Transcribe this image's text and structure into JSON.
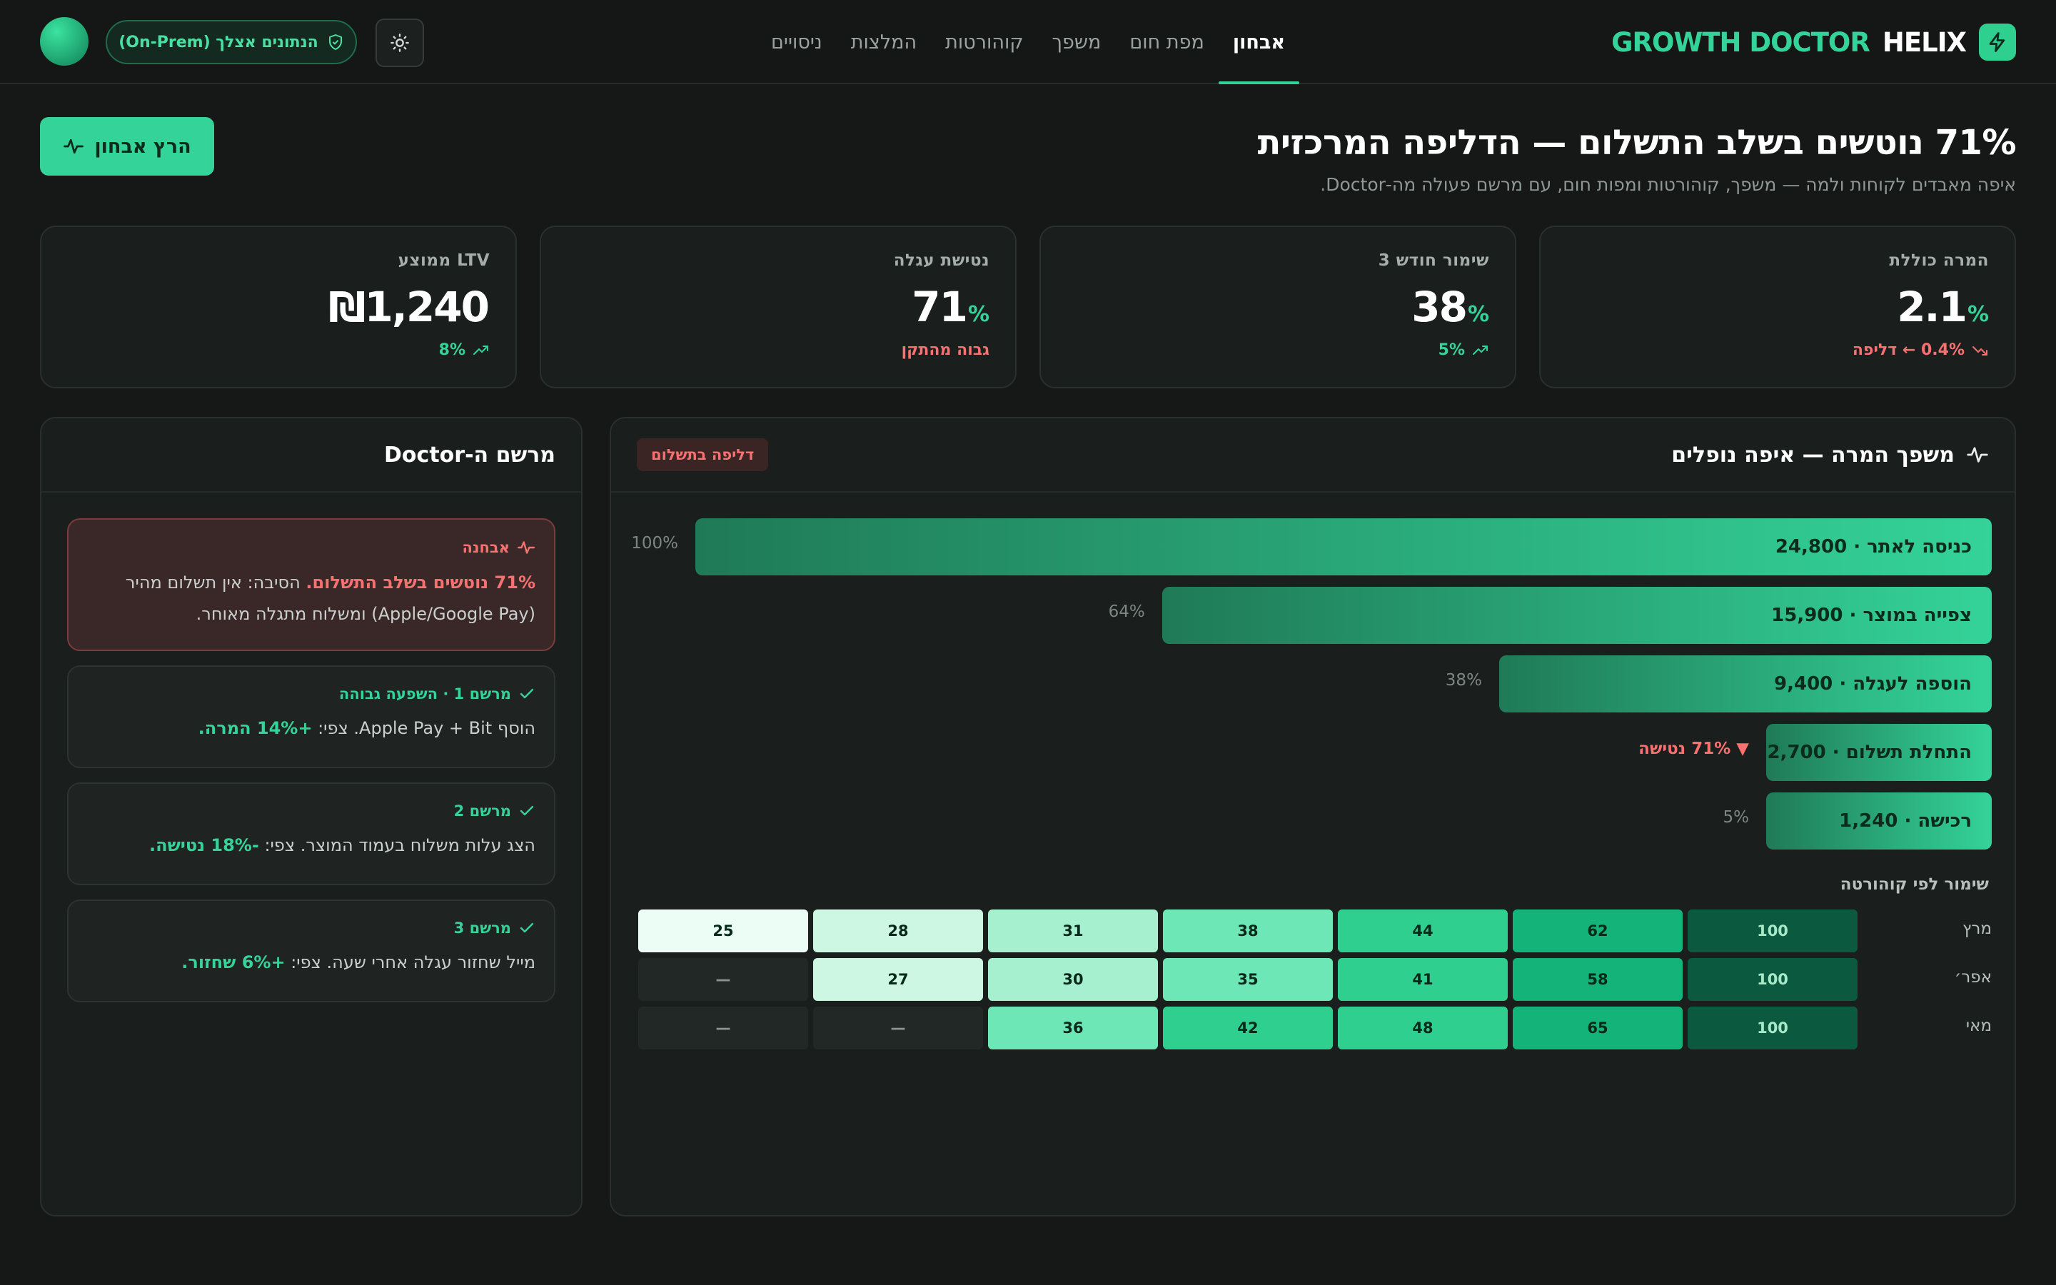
{
  "brand": {
    "word_green": "GROWTH DOCTOR",
    "word_white": "HELIX",
    "icon": "bolt-icon"
  },
  "nav": {
    "items": [
      "אבחון",
      "מפת חום",
      "משפך",
      "קוהורטות",
      "המלצות",
      "ניסויים"
    ],
    "active_index": 0
  },
  "header": {
    "data_pill": "הנתונים אצלך (On-Prem)",
    "theme_icon": "sun-icon"
  },
  "hero": {
    "title": "71% נוטשים בשלב התשלום — הדליפה המרכזית",
    "subtitle": "איפה מאבדים לקוחות ולמה — משפך, קוהורטות ומפות חום, עם מרשם פעולה מה-Doctor.",
    "run_button": "הרץ אבחון"
  },
  "kpis": [
    {
      "label": "המרה כוללת",
      "value": "2.1",
      "unit": "%",
      "foot": "0.4% ← דליפה",
      "trend": "down"
    },
    {
      "label": "שימור חודש 3",
      "value": "38",
      "unit": "%",
      "foot": "5%",
      "trend": "up"
    },
    {
      "label": "נטישת עגלה",
      "value": "71",
      "unit": "%",
      "foot": "גבוה מהתקן",
      "trend": "warn"
    },
    {
      "label": "LTV ממוצע",
      "value": "₪1,240",
      "unit": "",
      "foot": "8%",
      "trend": "up"
    }
  ],
  "funnel": {
    "title": "משפך המרה — איפה נופלים",
    "badge": "דליפה בתשלום",
    "steps": [
      {
        "label": "כניסה לאתר · 24,800",
        "pct": "100%",
        "pct_value": 100
      },
      {
        "label": "צפייה במוצר · 15,900",
        "pct": "64%",
        "pct_value": 64
      },
      {
        "label": "הוספה לעגלה · 9,400",
        "pct": "38%",
        "pct_value": 38
      },
      {
        "label": "התחלת תשלום · 2,700",
        "pct": "▼ 71% נטישה",
        "pct_value": 11
      },
      {
        "label": "רכישה · 1,240",
        "pct": "5%",
        "pct_value": 5
      }
    ]
  },
  "cohorts": {
    "title": "שימור לפי קוהורטה",
    "rows": [
      {
        "label": "מרץ",
        "values": [
          "100",
          "62",
          "44",
          "38",
          "31",
          "28",
          "25"
        ]
      },
      {
        "label": "אפר׳",
        "values": [
          "100",
          "58",
          "41",
          "35",
          "30",
          "27",
          "—"
        ]
      },
      {
        "label": "מאי",
        "values": [
          "100",
          "65",
          "48",
          "42",
          "36",
          "—",
          "—"
        ]
      }
    ]
  },
  "doctor": {
    "title": "מרשם ה-Doctor",
    "diagnosis": {
      "tag": "אבחנה",
      "highlight": "71% נוטשים בשלב התשלום.",
      "text": " הסיבה: אין תשלום מהיר (Apple/Google Pay) ומשלוח מתגלה מאוחר."
    },
    "prescriptions": [
      {
        "tag": "מרשם 1 · השפעה גבוהה",
        "text": "הוסף Apple Pay + Bit. צפי: ",
        "highlight": "+14% המרה."
      },
      {
        "tag": "מרשם 2",
        "text": "הצג עלות משלוח בעמוד המוצר. צפי: ",
        "highlight": "-18% נטישה."
      },
      {
        "tag": "מרשם 3",
        "text": "מייל שחזור עגלה אחרי שעה. צפי: ",
        "highlight": "+6% שחזור."
      }
    ]
  },
  "colors": {
    "accent": "#34d399",
    "danger": "#f87171",
    "background": "#151817",
    "panel": "#1a1e1d"
  }
}
